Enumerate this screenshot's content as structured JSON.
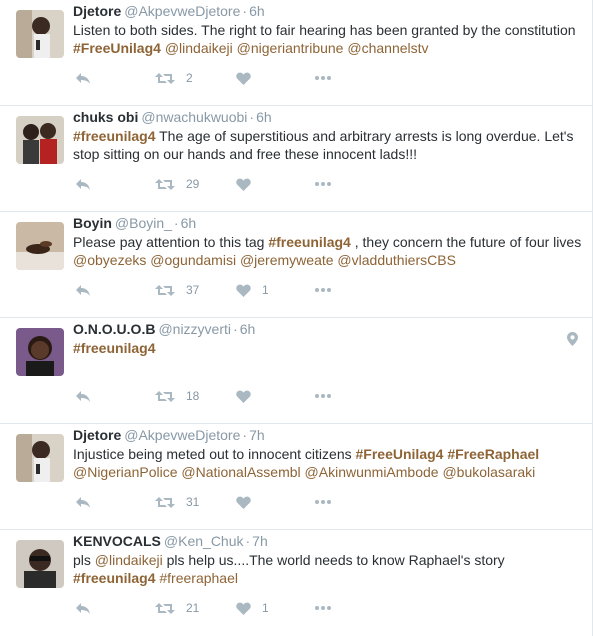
{
  "colors": {
    "link": "#8e6436",
    "muted": "#8899a6",
    "icon": "#aab8c2",
    "border": "#e1e8ed"
  },
  "tweets": [
    {
      "name": "Djetore",
      "handle": "@AkpevweDjetore",
      "sep": "·",
      "time": "6h",
      "segments": [
        {
          "t": "text",
          "v": "Listen to both sides. The right to fair hearing has been granted by the constitution "
        },
        {
          "t": "hashtag",
          "v": "#FreeUnilag4"
        },
        {
          "t": "text",
          "v": " "
        },
        {
          "t": "mention",
          "v": "@lindaikeji"
        },
        {
          "t": "text",
          "v": " "
        },
        {
          "t": "mention",
          "v": "@nigeriantribune"
        },
        {
          "t": "text",
          "v": " "
        },
        {
          "t": "mention",
          "v": "@channelstv"
        }
      ],
      "retweets": "2",
      "likes": "",
      "has_location": false,
      "avatar": "djetore"
    },
    {
      "name": "chuks obi",
      "handle": "@nwachukwuobi",
      "sep": "·",
      "time": "6h",
      "segments": [
        {
          "t": "hashtag",
          "v": "#freeunilag4"
        },
        {
          "t": "text",
          "v": " The age of superstitious and arbitrary arrests is long overdue. Let's stop sitting on our hands and free these innocent lads!!!"
        }
      ],
      "retweets": "29",
      "likes": "",
      "has_location": false,
      "avatar": "chuks"
    },
    {
      "name": "Boyin",
      "handle": "@Boyin_",
      "sep": "·",
      "time": "6h",
      "segments": [
        {
          "t": "text",
          "v": "Please pay attention to this tag "
        },
        {
          "t": "hashtag",
          "v": "#freeunilag4"
        },
        {
          "t": "text",
          "v": " ,  they concern the future of four lives "
        },
        {
          "t": "mention",
          "v": "@obyezeks"
        },
        {
          "t": "text",
          "v": " "
        },
        {
          "t": "mention",
          "v": "@ogundamisi"
        },
        {
          "t": "text",
          "v": " "
        },
        {
          "t": "mention",
          "v": "@jeremyweate"
        },
        {
          "t": "text",
          "v": " "
        },
        {
          "t": "mention",
          "v": "@vladduthiersCBS"
        }
      ],
      "retweets": "37",
      "likes": "1",
      "has_location": false,
      "avatar": "boyin"
    },
    {
      "name": "O.N.O.U.O.B",
      "handle": "@nizzyverti",
      "sep": "·",
      "time": "6h",
      "segments": [
        {
          "t": "hashtag",
          "v": "#freeunilag4"
        }
      ],
      "retweets": "18",
      "likes": "",
      "has_location": true,
      "avatar": "onouob"
    },
    {
      "name": "Djetore",
      "handle": "@AkpevweDjetore",
      "sep": "·",
      "time": "7h",
      "segments": [
        {
          "t": "text",
          "v": "Injustice being meted out to innocent citizens "
        },
        {
          "t": "hashtag",
          "v": "#FreeUnilag4"
        },
        {
          "t": "text",
          "v": "  "
        },
        {
          "t": "hashtag",
          "v": "#FreeRaphael"
        },
        {
          "t": "text",
          "v": " "
        },
        {
          "t": "mention",
          "v": "@NigerianPolice"
        },
        {
          "t": "text",
          "v": " "
        },
        {
          "t": "mention",
          "v": "@NationalAssembl"
        },
        {
          "t": "text",
          "v": " "
        },
        {
          "t": "mention",
          "v": "@AkinwunmiAmbode"
        },
        {
          "t": "text",
          "v": " "
        },
        {
          "t": "mention",
          "v": "@bukolasaraki"
        }
      ],
      "retweets": "31",
      "likes": "",
      "has_location": false,
      "avatar": "djetore"
    },
    {
      "name": "KENVOCALS",
      "handle": "@Ken_Chuk",
      "sep": "·",
      "time": "7h",
      "segments": [
        {
          "t": "text",
          "v": "pls "
        },
        {
          "t": "mention",
          "v": "@lindaikeji"
        },
        {
          "t": "text",
          "v": " pls help us....The world needs to know Raphael's story "
        },
        {
          "t": "hashtag",
          "v": "#freeunilag4"
        },
        {
          "t": "text",
          "v": " "
        },
        {
          "t": "mention",
          "v": "#freeraphael"
        }
      ],
      "retweets": "21",
      "likes": "1",
      "has_location": false,
      "avatar": "kenvocals"
    }
  ]
}
